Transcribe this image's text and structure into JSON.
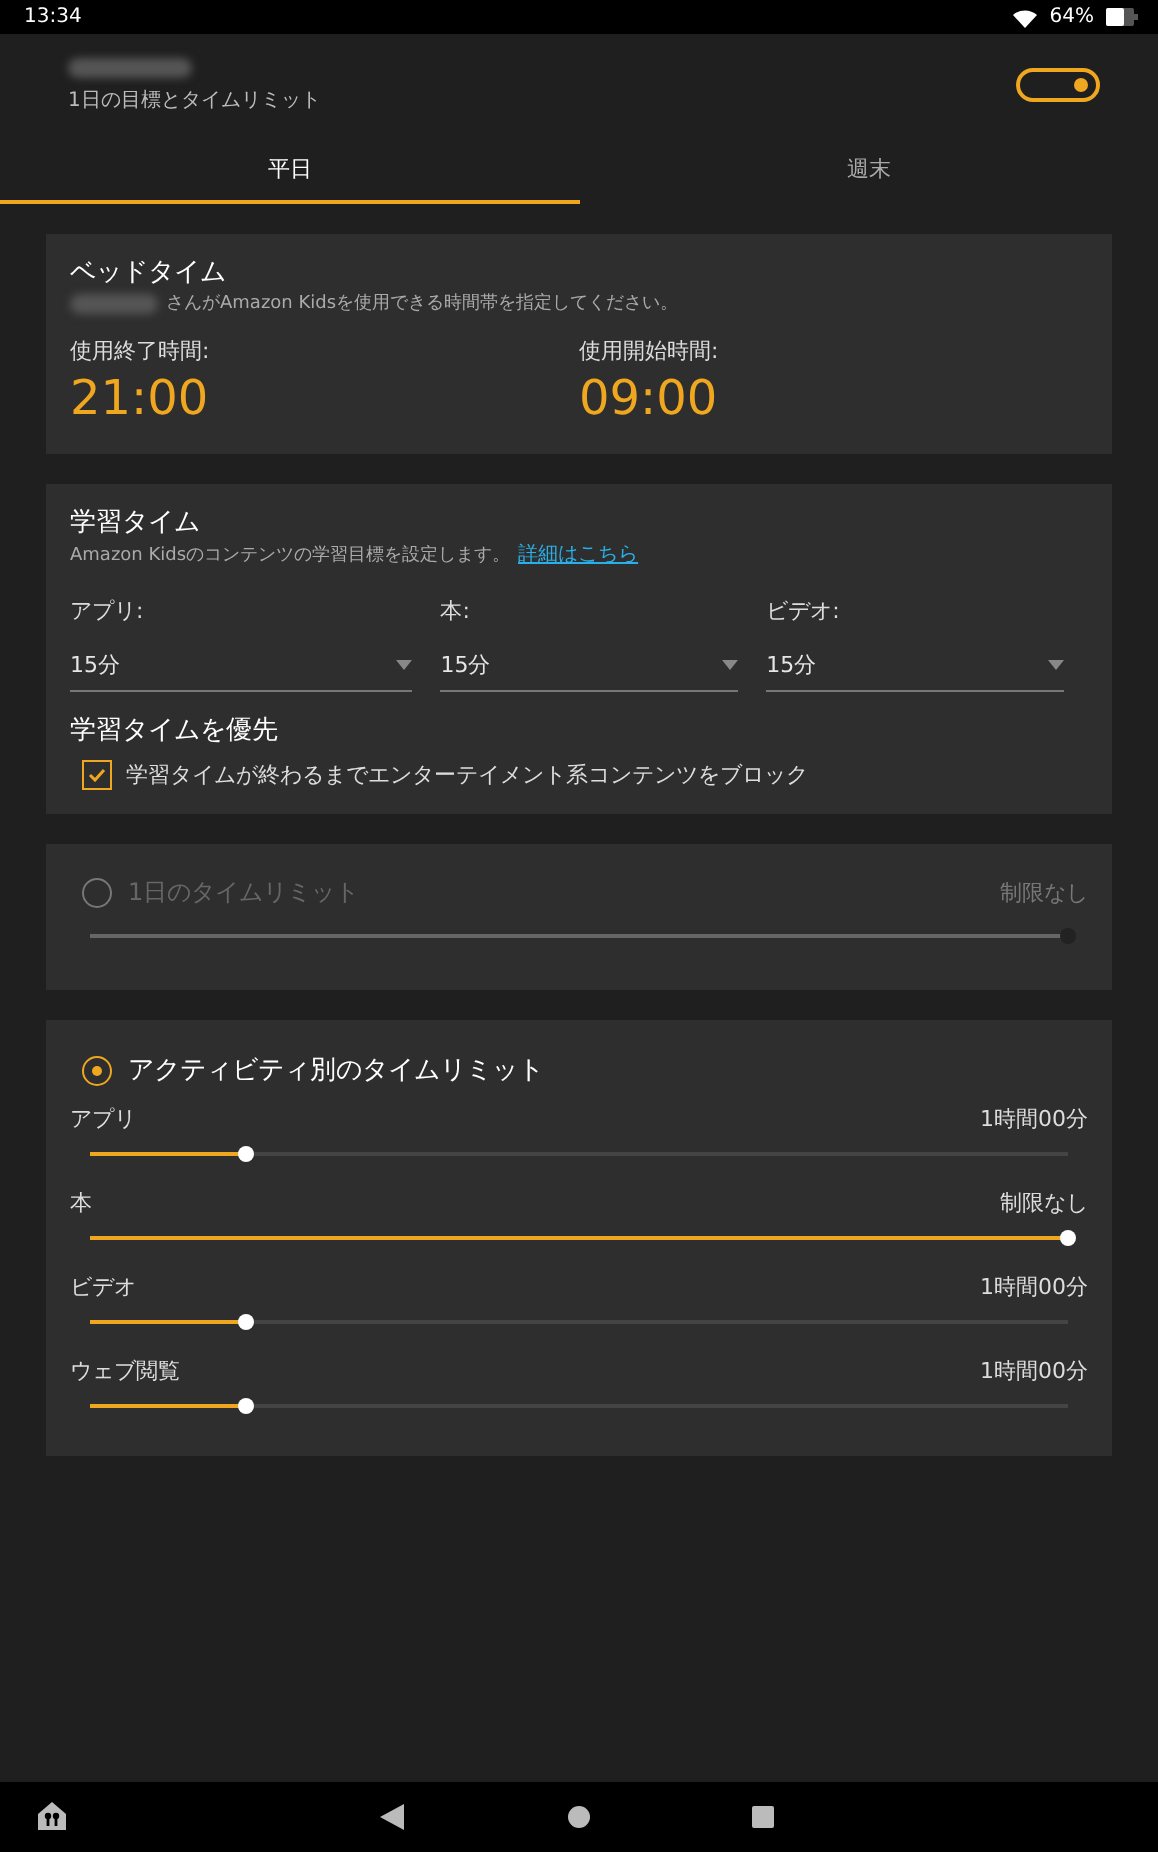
{
  "status_bar": {
    "time": "13:34",
    "battery": "64%"
  },
  "header": {
    "subtitle": "1日の目標とタイムリミット",
    "toggle_on": true
  },
  "tabs": [
    {
      "label": "平日",
      "selected": true
    },
    {
      "label": "週末",
      "selected": false
    }
  ],
  "bedtime": {
    "title": "ベッドタイム",
    "description": "さんがAmazon Kidsを使用できる時間帯を指定してください。",
    "times": [
      {
        "label": "使用終了時間:",
        "value": "21:00"
      },
      {
        "label": "使用開始時間:",
        "value": "09:00"
      }
    ]
  },
  "learning": {
    "title": "学習タイム",
    "description": "Amazon Kidsのコンテンツの学習目標を設定します。",
    "link": "詳細はこちら",
    "dropdowns": [
      {
        "label": "アプリ:",
        "value": "15分"
      },
      {
        "label": "本:",
        "value": "15分"
      },
      {
        "label": "ビデオ:",
        "value": "15分"
      }
    ],
    "priority_title": "学習タイムを優先",
    "priority_checkbox": {
      "label": "学習タイムが終わるまでエンターテイメント系コンテンツをブロック",
      "checked": true
    }
  },
  "daily_limit": {
    "label": "1日のタイムリミット",
    "selected": false,
    "value": "制限なし",
    "level": 1
  },
  "activity_limit": {
    "label": "アクティビティ別のタイムリミット",
    "selected": true,
    "items": [
      {
        "name": "アプリ",
        "value": "1時間00分",
        "level": 0.16
      },
      {
        "name": "本",
        "value": "制限なし",
        "level": 1
      },
      {
        "name": "ビデオ",
        "value": "1時間00分",
        "level": 0.16
      },
      {
        "name": "ウェブ閲覧",
        "value": "1時間00分",
        "level": 0.16
      }
    ]
  }
}
